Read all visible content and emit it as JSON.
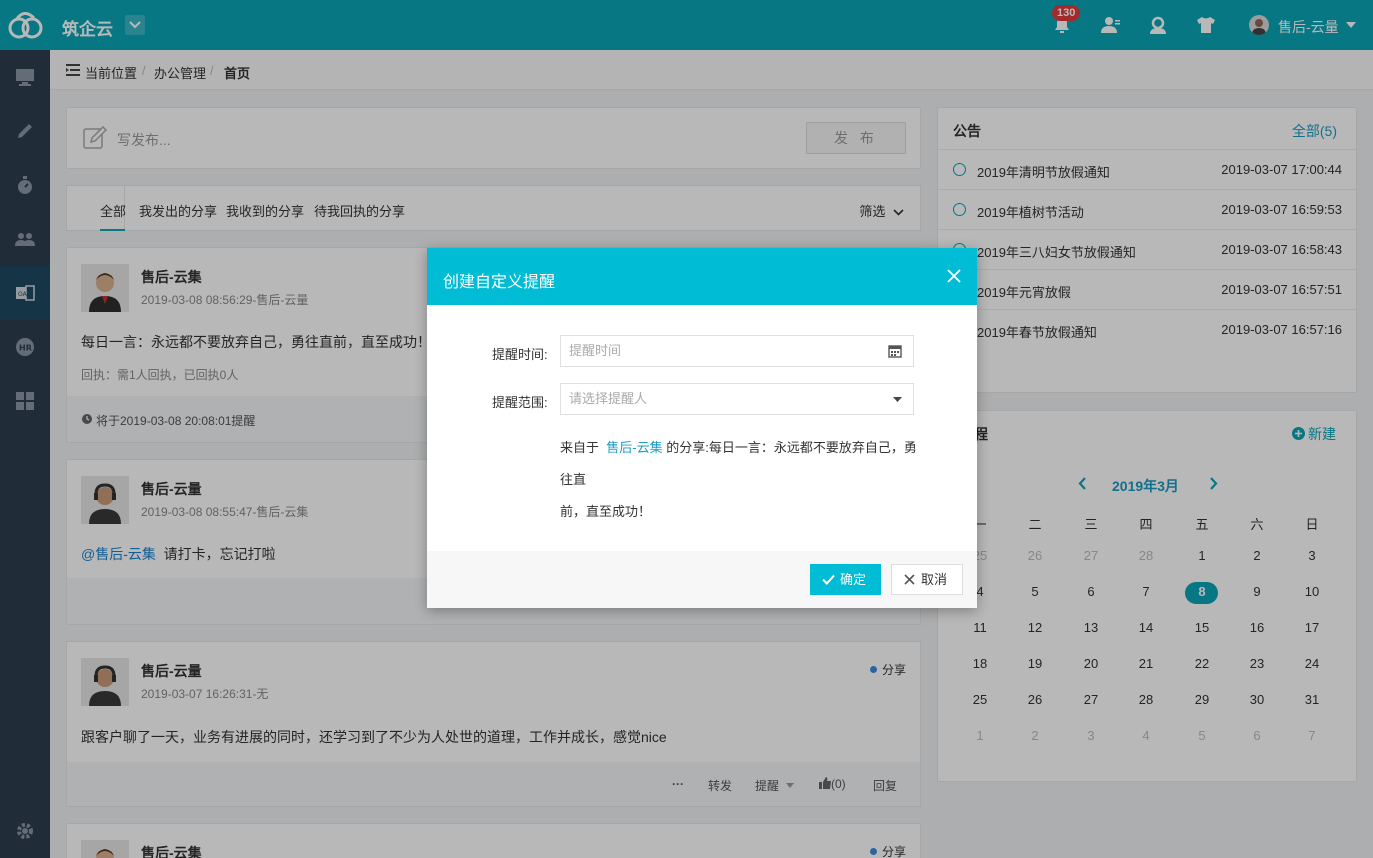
{
  "app": {
    "title": "筑企云",
    "notification_count": "130",
    "user_name": "售后-云量"
  },
  "breadcrumb": {
    "label": "当前位置",
    "items": [
      "办公管理",
      "首页"
    ]
  },
  "composer": {
    "placeholder": "写发布...",
    "submit_label": "发 布"
  },
  "tabs": {
    "items": [
      "全部",
      "我发出的分享",
      "我收到的分享",
      "待我回执的分享"
    ],
    "filter_label": "筛选"
  },
  "feed": [
    {
      "author": "售后-云集",
      "meta": "2019-03-08 08:56:29-售后-云量",
      "text": "每日一言：永远都不要放弃自己，勇往直前，直至成功！",
      "receipt": "回执：需1人回执，已回执0人",
      "reminder": "将于2019-03-08 20:08:01提醒"
    },
    {
      "author": "售后-云量",
      "meta": "2019-03-08 08:55:47-售后-云集",
      "mention": "@售后-云集",
      "text": "请打卡，忘记打啦"
    },
    {
      "author": "售后-云量",
      "meta": "2019-03-07 16:26:31-无",
      "type": "分享",
      "text": "跟客户聊了一天，业务有进展的同时，还学习到了不少为人处世的道理，工作并成长，感觉nice",
      "actions": {
        "more": "···",
        "forward": "转发",
        "remind": "提醒",
        "like": "(0)",
        "reply": "回复"
      }
    },
    {
      "author": "售后-云集",
      "type": "分享"
    }
  ],
  "notice": {
    "title": "公告",
    "all_label": "全部(5)",
    "items": [
      {
        "title": "2019年清明节放假通知",
        "date": "2019-03-07 17:00:44"
      },
      {
        "title": "2019年植树节活动",
        "date": "2019-03-07 16:59:53"
      },
      {
        "title": "2019年三八妇女节放假通知",
        "date": "2019-03-07 16:58:43"
      },
      {
        "title": "2019年元宵放假",
        "date": "2019-03-07 16:57:51"
      },
      {
        "title": "2019年春节放假通知",
        "date": "2019-03-07 16:57:16"
      }
    ]
  },
  "calendar": {
    "title": "程",
    "new_label": "新建",
    "month": "2019年3月",
    "weekdays": [
      "一",
      "二",
      "三",
      "四",
      "五",
      "六",
      "日"
    ],
    "weeks": [
      [
        "25",
        "26",
        "27",
        "28",
        "1",
        "2",
        "3"
      ],
      [
        "4",
        "5",
        "6",
        "7",
        "8",
        "9",
        "10"
      ],
      [
        "11",
        "12",
        "13",
        "14",
        "15",
        "16",
        "17"
      ],
      [
        "18",
        "19",
        "20",
        "21",
        "22",
        "23",
        "24"
      ],
      [
        "25",
        "26",
        "27",
        "28",
        "29",
        "30",
        "31"
      ],
      [
        "1",
        "2",
        "3",
        "4",
        "5",
        "6",
        "7"
      ]
    ],
    "today": "8"
  },
  "modal": {
    "title": "创建自定义提醒",
    "time_label": "提醒时间:",
    "time_placeholder": "提醒时间",
    "scope_label": "提醒范围:",
    "scope_placeholder": "请选择提醒人",
    "source_prefix": "来自于",
    "source_user": "售后-云集",
    "source_line1": "的分享:每日一言：永远都不要放弃自己，勇往直",
    "source_line2": "前，直至成功！",
    "ok_label": "确定",
    "cancel_label": "取消"
  },
  "colors": {
    "brand": "#0aa5b8",
    "modal_header": "#00bcd4",
    "sidebar": "#2e3d50",
    "badge": "#e23b3b"
  }
}
